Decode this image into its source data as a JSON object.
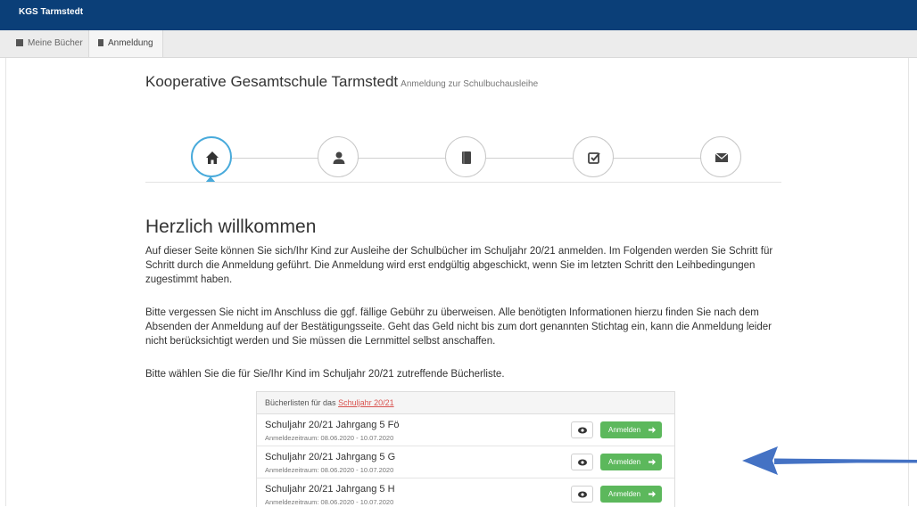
{
  "app": {
    "brand": "KGS Tarmstedt"
  },
  "nav": {
    "tabs": [
      {
        "label": "Meine Bücher",
        "icon": "book-icon",
        "active": false
      },
      {
        "label": "Anmeldung",
        "icon": "file-icon",
        "active": true
      }
    ]
  },
  "header": {
    "title": "Kooperative Gesamtschule Tarmstedt",
    "subtitle": "Anmeldung zur Schulbuchausleihe"
  },
  "steps": [
    {
      "icon": "home-icon",
      "active": true
    },
    {
      "icon": "user-icon",
      "active": false
    },
    {
      "icon": "book-icon",
      "active": false
    },
    {
      "icon": "checkbox-icon",
      "active": false
    },
    {
      "icon": "envelope-icon",
      "active": false
    }
  ],
  "welcome": {
    "heading": "Herzlich willkommen",
    "paragraph1": "Auf dieser Seite können Sie sich/Ihr Kind zur Ausleihe der Schulbücher im Schuljahr 20/21 anmelden. Im Folgenden werden Sie Schritt für Schritt durch die Anmeldung geführt. Die Anmeldung wird erst endgültig abgeschickt, wenn Sie im letzten Schritt den Leihbedingungen zugestimmt haben.",
    "paragraph2": "Bitte vergessen Sie nicht im Anschluss die ggf. fällige Gebühr zu überweisen. Alle benötigten Informationen hierzu finden Sie nach dem Absenden der Anmeldung auf der Bestätigungsseite. Geht das Geld nicht bis zum dort genannten Stichtag ein, kann die Anmeldung leider nicht berücksichtigt werden und Sie müssen die Lernmittel selbst anschaffen.",
    "paragraph3": "Bitte wählen Sie die für Sie/Ihr Kind im Schuljahr 20/21 zutreffende Bücherliste."
  },
  "booklists": {
    "header_prefix": "Bücherlisten für das",
    "header_link": "Schuljahr 20/21",
    "rows": [
      {
        "title": "Schuljahr 20/21 Jahrgang 5 Fö",
        "period": "Anmeldezeitraum: 08.06.2020 - 10.07.2020",
        "button": "Anmelden"
      },
      {
        "title": "Schuljahr 20/21 Jahrgang 5 G",
        "period": "Anmeldezeitraum: 08.06.2020 - 10.07.2020",
        "button": "Anmelden"
      },
      {
        "title": "Schuljahr 20/21 Jahrgang 5 H",
        "period": "Anmeldezeitraum: 08.06.2020 - 10.07.2020",
        "button": "Anmelden"
      }
    ]
  },
  "colors": {
    "topbar": "#0b3f78",
    "active_step": "#48aadb",
    "register_button": "#5cb85c",
    "link": "#d9534f",
    "annotation_arrow": "#4472c4"
  }
}
